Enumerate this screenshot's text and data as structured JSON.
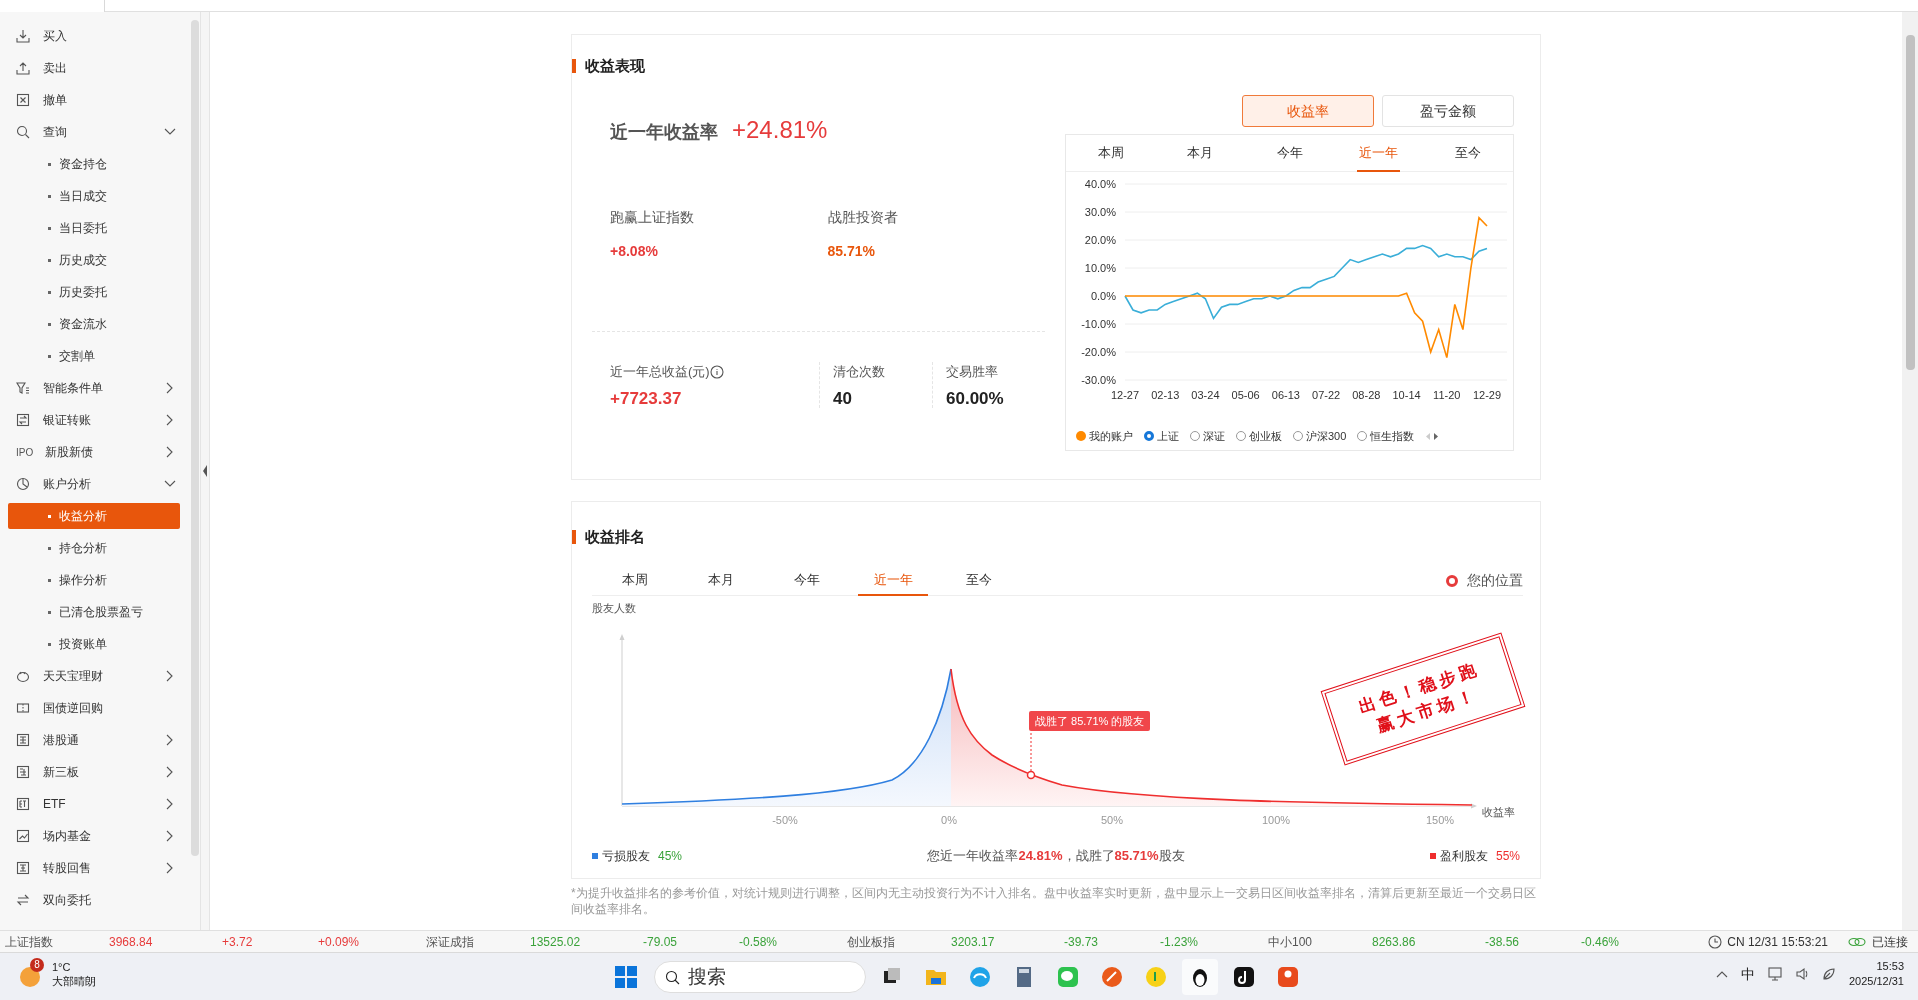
{
  "sidebar": {
    "items": [
      {
        "kind": "link",
        "label": "买入"
      },
      {
        "kind": "link",
        "label": "卖出"
      },
      {
        "kind": "link",
        "label": "撤单"
      },
      {
        "kind": "group",
        "label": "查询",
        "expanded": true,
        "children": [
          {
            "label": "资金持仓",
            "selected": false
          },
          {
            "label": "当日成交",
            "selected": false
          },
          {
            "label": "当日委托",
            "selected": false
          },
          {
            "label": "历史成交",
            "selected": false
          },
          {
            "label": "历史委托",
            "selected": false
          },
          {
            "label": "资金流水",
            "selected": false
          },
          {
            "label": "交割单",
            "selected": false
          }
        ]
      },
      {
        "kind": "group",
        "label": "智能条件单",
        "expanded": false
      },
      {
        "kind": "group",
        "label": "银证转账",
        "expanded": false
      },
      {
        "kind": "group",
        "label": "新股新债",
        "expanded": false,
        "icon_text": "IPO"
      },
      {
        "kind": "group",
        "label": "账户分析",
        "expanded": true,
        "children": [
          {
            "label": "收益分析",
            "selected": true
          },
          {
            "label": "持仓分析",
            "selected": false
          },
          {
            "label": "操作分析",
            "selected": false
          },
          {
            "label": "已清仓股票盈亏",
            "selected": false
          },
          {
            "label": "投资账单",
            "selected": false
          }
        ]
      },
      {
        "kind": "group",
        "label": "天天宝理财",
        "expanded": false
      },
      {
        "kind": "link",
        "label": "国债逆回购"
      },
      {
        "kind": "group",
        "label": "港股通",
        "expanded": false
      },
      {
        "kind": "group",
        "label": "新三板",
        "expanded": false
      },
      {
        "kind": "group",
        "label": "ETF",
        "expanded": false
      },
      {
        "kind": "group",
        "label": "场内基金",
        "expanded": false
      },
      {
        "kind": "group",
        "label": "转股回售",
        "expanded": false
      },
      {
        "kind": "link",
        "label": "双向委托"
      }
    ]
  },
  "performance": {
    "title": "收益表现",
    "headline_label": "近一年收益率",
    "headline_value": "+24.81%",
    "stats_top": [
      {
        "label": "跑赢上证指数",
        "value": "+8.08%",
        "color": "#e63b3b"
      },
      {
        "label": "战胜投资者",
        "value": "85.71%",
        "color": "#e8560c"
      }
    ],
    "stats_bottom": [
      {
        "label": "近一年总收益(元)",
        "value": "+7723.37",
        "color": "#e63b3b",
        "info": true
      },
      {
        "label": "清仓次数",
        "value": "40",
        "color": "#222222",
        "info": false
      },
      {
        "label": "交易胜率",
        "value": "60.00%",
        "color": "#222222",
        "info": false
      }
    ],
    "toggle": [
      {
        "label": "收益率",
        "selected": true
      },
      {
        "label": "盈亏金额",
        "selected": false
      }
    ],
    "periods": [
      {
        "label": "本周",
        "selected": false
      },
      {
        "label": "本月",
        "selected": false
      },
      {
        "label": "今年",
        "selected": false
      },
      {
        "label": "近一年",
        "selected": true
      },
      {
        "label": "至今",
        "selected": false
      }
    ],
    "chart_data": {
      "type": "line",
      "categories": [
        "12-27",
        null,
        null,
        null,
        null,
        "02-13",
        null,
        null,
        null,
        null,
        "03-24",
        null,
        null,
        null,
        null,
        "05-06",
        null,
        null,
        null,
        null,
        "06-13",
        null,
        null,
        null,
        null,
        "07-22",
        null,
        null,
        null,
        null,
        "08-28",
        null,
        null,
        null,
        null,
        "10-14",
        null,
        null,
        null,
        null,
        "11-20",
        null,
        null,
        null,
        null,
        "12-29"
      ],
      "series": [
        {
          "name": "我的账户",
          "color": "#ff8a00",
          "values": [
            0,
            0,
            0,
            0,
            0,
            0,
            0,
            0,
            0,
            0,
            0,
            0,
            0,
            0,
            0,
            0,
            0,
            0,
            0,
            0,
            0,
            0,
            0,
            0,
            0,
            0,
            0,
            0,
            0,
            0,
            0,
            0,
            0,
            0,
            0,
            1,
            -6,
            -9,
            -20,
            -12,
            -22,
            -3,
            -12,
            10,
            28,
            25
          ]
        },
        {
          "name": "上证",
          "color": "#3aaed8",
          "values": [
            0,
            -5,
            -6,
            -5,
            -5,
            -3,
            -2,
            -1,
            0,
            1,
            -1,
            -8,
            -4,
            -3,
            -3,
            -2,
            -1,
            -1,
            0,
            -1,
            0,
            2,
            3,
            3,
            5,
            6,
            7,
            10,
            13,
            12,
            13,
            14,
            15,
            14,
            15,
            17,
            17,
            18,
            17,
            14,
            15,
            14,
            14,
            13,
            16,
            17
          ]
        }
      ],
      "ylim": [
        -30,
        40
      ],
      "grid": true,
      "yticks": [
        {
          "value": 40,
          "label": "40.0%"
        },
        {
          "value": 30,
          "label": "30.0%"
        },
        {
          "value": 20,
          "label": "20.0%"
        },
        {
          "value": 10,
          "label": "10.0%"
        },
        {
          "value": 0,
          "label": "0.0%"
        },
        {
          "value": -10,
          "label": "-10.0%"
        },
        {
          "value": -20,
          "label": "-20.0%"
        },
        {
          "value": -30,
          "label": "-30.0%"
        }
      ]
    },
    "legend": [
      {
        "label": "深证",
        "selected": false
      },
      {
        "label": "创业板",
        "selected": false
      },
      {
        "label": "沪深300",
        "selected": false
      },
      {
        "label": "恒生指数",
        "selected": false
      }
    ]
  },
  "ranking": {
    "title": "收益排名",
    "periods": [
      {
        "label": "本周",
        "selected": false
      },
      {
        "label": "本月",
        "selected": false
      },
      {
        "label": "今年",
        "selected": false
      },
      {
        "label": "近一年",
        "selected": true
      },
      {
        "label": "至今",
        "selected": false
      }
    ],
    "position_label": "您的位置",
    "y_label": "股友人数",
    "x_label": "收益率",
    "x_tick_labels": [
      "-50%",
      "0%",
      "50%",
      "100%",
      "150%"
    ],
    "tooltip": "战胜了 85.71% 的股友",
    "stamp_lines": [
      "出色！稳步跑",
      "赢大市场！"
    ],
    "loss": {
      "label": "亏损股友",
      "value": "45%"
    },
    "summary": "您近一年收益率**24.81%**，战胜了**85.71%**股友",
    "profit": {
      "label": "盈利股友",
      "value": "55%"
    }
  },
  "footnote": "*为提升收益排名的参考价值，对统计规则进行调整，区间内无主动投资行为不计入排名。盘中收益率实时更新，盘中显示上一交易日区间收益率排名，清算后更新至最近一个交易日区间收益率排名。",
  "ticker": [
    {
      "name": "上证指数",
      "value": "3968.84",
      "change": "+3.72",
      "pct": "+0.09%",
      "color": "#e63b3b"
    },
    {
      "name": "深证成指",
      "value": "13525.02",
      "change": "-79.05",
      "pct": "-0.58%",
      "color": "#3aa23a"
    },
    {
      "name": "创业板指",
      "value": "3203.17",
      "change": "-39.73",
      "pct": "-1.23%",
      "color": "#3aa23a"
    },
    {
      "name": "中小100",
      "value": "8263.86",
      "change": "-38.56",
      "pct": "-0.46%",
      "color": "#3aa23a"
    }
  ],
  "status": {
    "time": "CN 12/31 15:53:21",
    "connection": "已连接"
  },
  "taskbar": {
    "weather_badge": "8",
    "temperature": "1°C",
    "weather": "大部晴朗",
    "search": "搜索",
    "ime": "中",
    "clock_time": "15:53",
    "clock_date": "2025/12/31"
  }
}
